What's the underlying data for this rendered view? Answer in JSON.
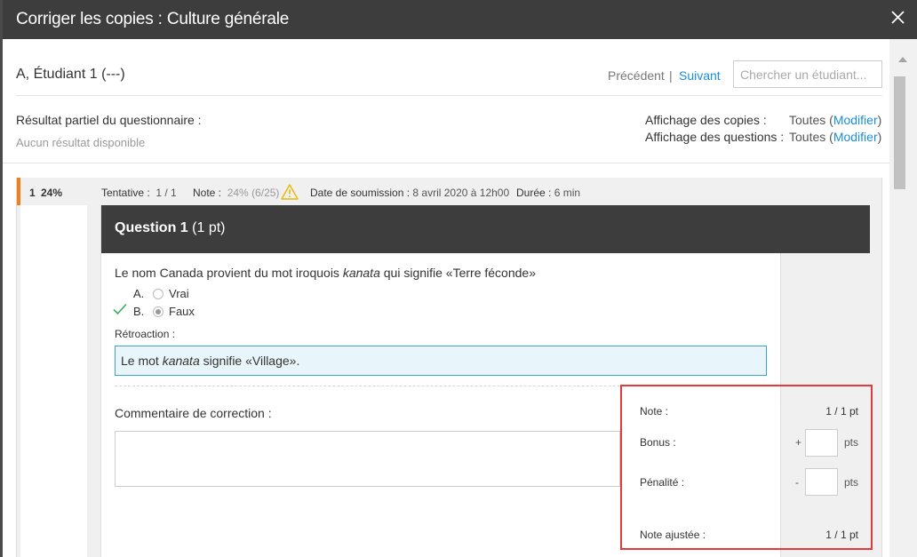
{
  "header": {
    "title": "Corriger les copies : Culture générale"
  },
  "student": {
    "name": "A, Étudiant 1 (---)",
    "prev_label": "Précédent",
    "separator": "|",
    "next_label": "Suivant",
    "search_placeholder": "Chercher un étudiant..."
  },
  "partial": {
    "label": "Résultat partiel du questionnaire :",
    "value": "Aucun résultat disponible"
  },
  "display": {
    "copies_label": "Affichage des copies :",
    "copies_value": "Toutes (",
    "copies_link": "Modifier",
    "copies_close": ")",
    "questions_label": "Affichage des questions :",
    "questions_value": "Toutes (",
    "questions_link": "Modifier",
    "questions_close": ")"
  },
  "attempt": {
    "number": "1",
    "percent": "24%",
    "tentative_label": "Tentative :",
    "tentative_value": "1 / 1",
    "note_label": "Note :",
    "note_pct": "24%",
    "note_frac": "(6/25)",
    "date_label": "Date de soumission :",
    "date_value": "8 avril 2020 à 12h00",
    "duree_label": "Durée :",
    "duree_value": "6 min",
    "accent_color": "#f0811a"
  },
  "question": {
    "title": "Question 1",
    "points": "(1 pt)",
    "text_before": "Le nom Canada provient du mot iroquois ",
    "text_italic": "kanata",
    "text_after": " qui signifie «Terre féconde»",
    "choices": [
      {
        "letter": "A.",
        "label": "Vrai",
        "checked": false,
        "correct": false
      },
      {
        "letter": "B.",
        "label": "Faux",
        "checked": true,
        "correct": true
      }
    ],
    "feedback_label": "Rétroaction :",
    "feedback_before": "Le mot ",
    "feedback_italic": "kanata",
    "feedback_after": " signifie «Village».",
    "comment_label": "Commentaire de correction :"
  },
  "grading": {
    "note_label": "Note :",
    "note_value": "1 / 1 pt",
    "bonus_label": "Bonus :",
    "bonus_sign": "+",
    "bonus_unit": "pts",
    "penalty_label": "Pénalité :",
    "penalty_sign": "-",
    "penalty_unit": "pts",
    "adjusted_label": "Note ajustée :",
    "adjusted_value": "1 / 1 pt",
    "highlight_color": "#e23b3b"
  },
  "icons": {
    "close": "close-icon",
    "warning": "warning-icon",
    "check": "check-icon"
  }
}
